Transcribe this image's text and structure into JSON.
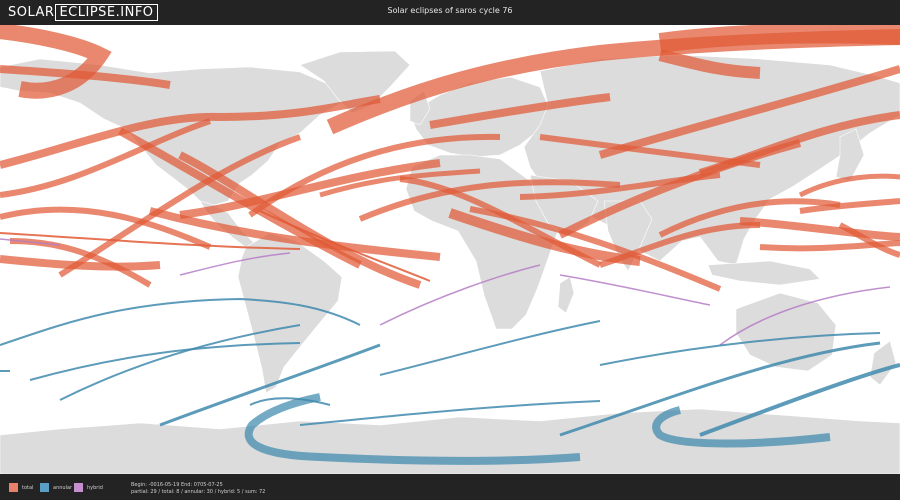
{
  "header": {
    "logo_left": "SOLAR",
    "logo_right": "ECLIPSE.INFO",
    "title": "Solar eclipses of saros cycle 76"
  },
  "legend": [
    {
      "label": "total",
      "color": "#e8816b"
    },
    {
      "label": "annular",
      "color": "#5a9fc4"
    },
    {
      "label": "hybrid",
      "color": "#c58fd0"
    }
  ],
  "footer": {
    "range_text": "Begin: -0016-05-19 End: 0705-07-25",
    "stats_text": "partial: 29 / total: 8 / annular: 30 / hybrid: 5 / sum: 72"
  },
  "map": {
    "colors": {
      "background": "#ffffff",
      "land": "#dcdcdc",
      "borders": "#ffffff",
      "total": "#e05a36",
      "annular": "#3f89ad",
      "hybrid": "#b57cc6"
    }
  }
}
